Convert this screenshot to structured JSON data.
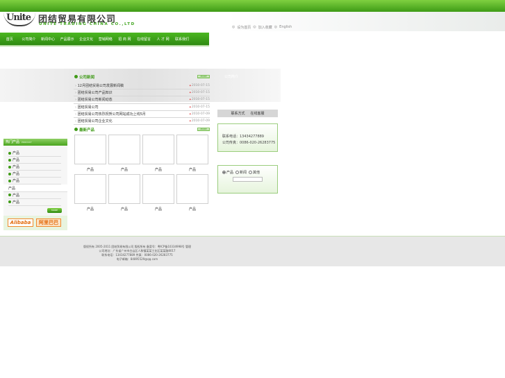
{
  "header": {
    "logo_mark": "Unite",
    "company_cn": "团结贸易有限公司",
    "company_en": "UNITE TRADING CHINA CO.,LTD",
    "top_links": [
      "设为首页",
      "加入收藏",
      "English"
    ]
  },
  "nav": {
    "items": [
      "首页",
      "公司简介",
      "新闻中心",
      "产品展示",
      "企业文化",
      "营销网络",
      "招 商 网",
      "在线留言",
      "人 才 网",
      "联系我们"
    ]
  },
  "banner": {
    "tag": "公司简介"
  },
  "news": {
    "title": "公司新闻",
    "more": "MORE",
    "items": [
      {
        "title": "12月团结贸易公司发展新闻稿",
        "date": "2010-07-15"
      },
      {
        "title": "团结贸易公司产品知识",
        "date": "2010-07-15"
      },
      {
        "title": "团结贸易公司新闻动态",
        "date": "2010-07-15"
      },
      {
        "title": "团结贸易公司",
        "date": "2010-07-15"
      },
      {
        "title": "团结贸易公司热烈祝贺公司网站成功上线5月",
        "date": "2010-07-09"
      },
      {
        "title": "团结贸易公司企业文化",
        "date": "2010-07-09"
      }
    ]
  },
  "products": {
    "title": "最新产品",
    "more": "MORE",
    "items": [
      "产品",
      "产品",
      "产品",
      "产品",
      "产品",
      "产品",
      "产品",
      "产品"
    ]
  },
  "sidebar": {
    "title": "热门产品",
    "subtitle": "PRODUCT",
    "items": [
      "产品",
      "产品",
      "产品",
      "产品",
      "产品",
      "产品",
      "产品",
      "产品"
    ],
    "more": "MORE",
    "partner_en": "Alibaba",
    "partner_cn": "阿里巴巴"
  },
  "contact": {
    "tabs": [
      "联系方式",
      "在线客服"
    ],
    "lines": [
      "联系电话：13434277889",
      "公司传真：0086-020-26283775"
    ]
  },
  "search": {
    "options": [
      "产品",
      "新闻",
      "其他"
    ],
    "selected": 0,
    "placeholder": ""
  },
  "footer": {
    "lines": [
      "版权所有 2005-2011 团结贸易有限公司 版权所有 备案号：粤ICP备10334998号 管理",
      "公司地址：广东省广州市白云区人和镇某某工业区某某路8017",
      "联系电话：13434277889 传真：0086-020-26283775",
      "电子邮箱：84895529@qq.com"
    ]
  }
}
